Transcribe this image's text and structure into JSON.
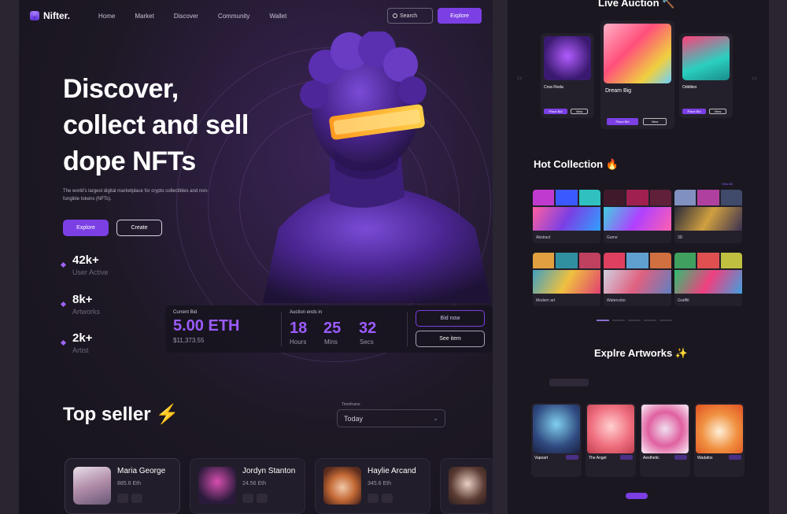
{
  "nav": {
    "brand": "Nifter.",
    "links": [
      "Home",
      "Market",
      "Discover",
      "Community",
      "Wallet"
    ],
    "search_label": "Search",
    "explore_label": "Explore"
  },
  "hero": {
    "title_lines": [
      "Discover,",
      "collect and sell",
      "dope NFTs"
    ],
    "subtitle": "The world's largest digital marketplace for crypto collectibles and non-fungible tokens (NFTs).",
    "explore_label": "Explore",
    "create_label": "Create"
  },
  "stats": [
    {
      "value": "42k+",
      "label": "User Active"
    },
    {
      "value": "8k+",
      "label": "Artworks"
    },
    {
      "value": "2k+",
      "label": "Artist"
    }
  ],
  "bid": {
    "current_label": "Current Bid",
    "eth": "5.00 ETH",
    "usd": "$11,373.55",
    "auction_label": "Auction ends in",
    "hours": "18",
    "hours_label": "Hours",
    "mins": "25",
    "mins_label": "Mins",
    "secs": "32",
    "secs_label": "Secs",
    "bid_now": "Bid now",
    "see_item": "See item"
  },
  "top_seller": {
    "title": "Top seller",
    "timeframe_label": "Timeframe",
    "timeframe_value": "Today",
    "sellers": [
      {
        "name": "Maria George",
        "eth": "885.6 Eth"
      },
      {
        "name": "Jordyn Stanton",
        "eth": "24.56 Eth"
      },
      {
        "name": "Haylie Arcand",
        "eth": "345.6 Eth"
      }
    ]
  },
  "live_auction": {
    "title": "Live Auction",
    "cards": [
      {
        "name": "Crea Fleda"
      },
      {
        "name": "Dream Big"
      },
      {
        "name": "Oddities"
      }
    ],
    "place_bid": "Place Bid",
    "view": "View"
  },
  "hot_collection": {
    "title": "Hot Collection",
    "view_all": "View All",
    "items": [
      {
        "name": "Abstract"
      },
      {
        "name": "Game"
      },
      {
        "name": "3D"
      },
      {
        "name": "Modern art"
      },
      {
        "name": "Watercolor"
      },
      {
        "name": "Graffiti"
      }
    ]
  },
  "explore_artworks": {
    "title": "Explre Artworks",
    "items": [
      {
        "name": "Vapoart"
      },
      {
        "name": "The Angel"
      },
      {
        "name": "Aesthetic"
      },
      {
        "name": "Wadafox"
      }
    ]
  },
  "colors": {
    "accent": "#7b3fe4",
    "accent_text": "#9b5bff",
    "bolt": "#f5b51d"
  }
}
